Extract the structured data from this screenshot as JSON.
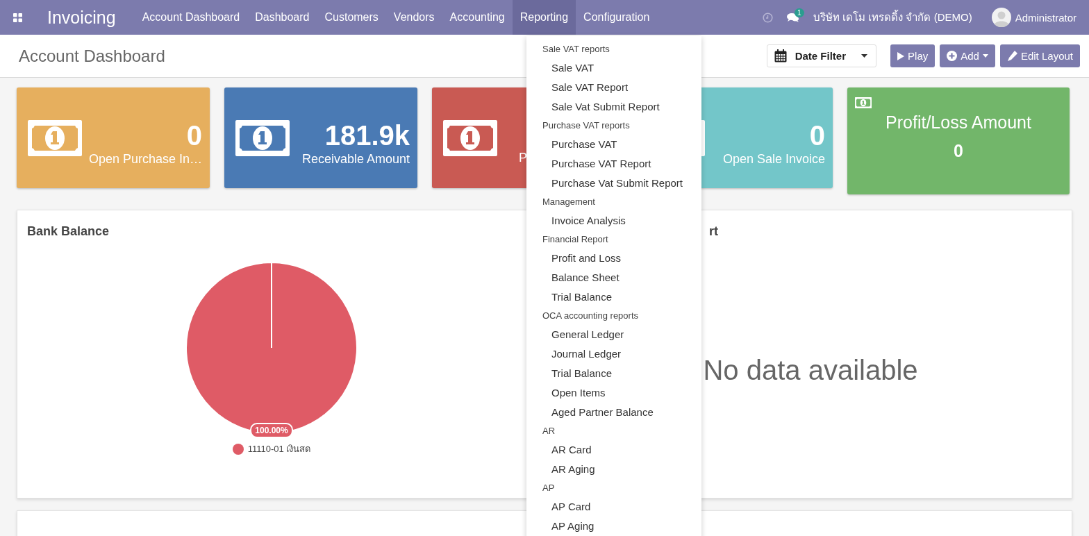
{
  "navbar": {
    "app_title": "Invoicing",
    "menus": [
      {
        "label": "Account Dashboard",
        "selected": false
      },
      {
        "label": "Dashboard",
        "selected": false
      },
      {
        "label": "Customers",
        "selected": false
      },
      {
        "label": "Vendors",
        "selected": false
      },
      {
        "label": "Accounting",
        "selected": false
      },
      {
        "label": "Reporting",
        "selected": true
      },
      {
        "label": "Configuration",
        "selected": false
      }
    ],
    "message_count": "1",
    "company": "บริษัท เดโม เทรดดิ้ง จำกัด (DEMO)",
    "user": "Administrator"
  },
  "control_panel": {
    "title": "Account Dashboard",
    "date_filter": "Date Filter",
    "play": "Play",
    "add": "Add",
    "edit_layout": "Edit Layout"
  },
  "tiles": [
    {
      "kind": "stat",
      "value": "0",
      "label": "Open Purchase In…",
      "color": "#e6af5e"
    },
    {
      "kind": "stat",
      "value": "181.9k",
      "label": "Receivable Amount",
      "color": "#4a7ab4"
    },
    {
      "kind": "stat",
      "label": "P",
      "color": "#c95a53"
    },
    {
      "kind": "stat",
      "value": "0",
      "label": "Open Sale Invoice",
      "color": "#73c6c9"
    },
    {
      "kind": "headline",
      "label": "Profit/Loss Amount",
      "value": "0",
      "color": "#72b66a"
    }
  ],
  "panels": [
    {
      "title": "Bank Balance",
      "chart_data": {
        "type": "pie",
        "categories": [
          "11110-01 เงินสด"
        ],
        "values": [
          100
        ],
        "value_labels": [
          "100.00%"
        ]
      }
    },
    {
      "title": "rt",
      "message": "No data available"
    }
  ],
  "reporting_menu": [
    {
      "header": "Sale VAT reports",
      "items": [
        "Sale VAT",
        "Sale VAT Report",
        "Sale Vat Submit Report"
      ]
    },
    {
      "header": "Purchase VAT reports",
      "items": [
        "Purchase VAT",
        "Purchase VAT Report",
        "Purchase Vat Submit Report"
      ]
    },
    {
      "header": "Management",
      "items": [
        "Invoice Analysis"
      ]
    },
    {
      "header": "Financial Report",
      "items": [
        "Profit and Loss",
        "Balance Sheet",
        "Trial Balance"
      ]
    },
    {
      "header": "OCA accounting reports",
      "items": [
        "General Ledger",
        "Journal Ledger",
        "Trial Balance",
        "Open Items",
        "Aged Partner Balance"
      ]
    },
    {
      "header": "AR",
      "items": [
        "AR Card",
        "AR Aging"
      ]
    },
    {
      "header": "AP",
      "items": [
        "AP Card",
        "AP Aging"
      ]
    }
  ]
}
